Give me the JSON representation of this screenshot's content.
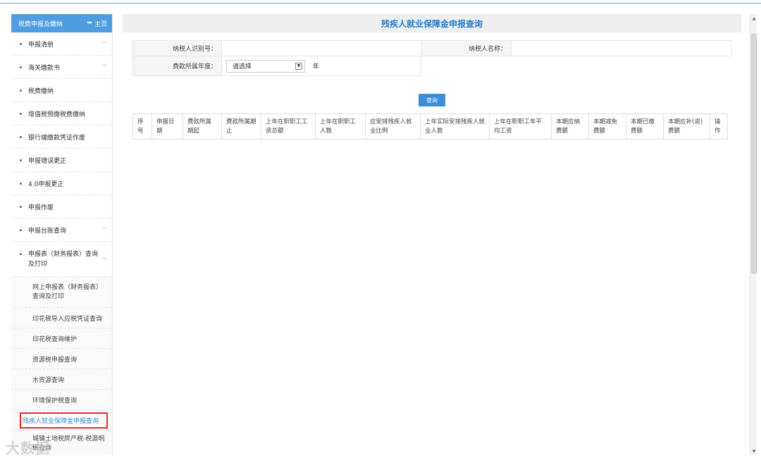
{
  "sidebar": {
    "header_title": "税费申报及缴纳",
    "home_label": "主页",
    "items": [
      {
        "label": "申报清册",
        "expandable": true
      },
      {
        "label": "海关缴款书",
        "expandable": true
      },
      {
        "label": "税费缴纳",
        "expandable": false
      },
      {
        "label": "增值税预缴税费缴纳",
        "expandable": false
      },
      {
        "label": "银行端缴款凭证作废",
        "expandable": false
      },
      {
        "label": "申报错误更正",
        "expandable": false
      },
      {
        "label": "4.0申报更正",
        "expandable": false
      },
      {
        "label": "申报作废",
        "expandable": false
      },
      {
        "label": "申报台账查询",
        "expandable": true
      },
      {
        "label": "申报表（财务报表）查询及打印",
        "expandable": true
      }
    ],
    "subitems": [
      "网上申报表（财务报表）查询及打印",
      "印花税导入应税凭证查询",
      "印花税查询维护",
      "资源税申报查询",
      "水资源查询",
      "环境保护税查询",
      "残疾人就业保障金申报查询",
      "城镇土地税房产税-税源明细查询"
    ]
  },
  "watermark": "大数据",
  "page_title": "残疾人就业保障金申报查询",
  "form": {
    "taxpayer_id_label": "纳税人识别号：",
    "taxpayer_id_value": "",
    "taxpayer_name_label": "纳税人名称：",
    "taxpayer_name_value": "",
    "year_label": "费款所属年度：",
    "year_select": "请选择",
    "year_unit": "年"
  },
  "query_button": "查询",
  "table": {
    "columns": [
      "序号",
      "申报日期",
      "费款所属期起",
      "费款所属期止",
      "上年在职职工工资总额",
      "上年在职职工人数",
      "应安排残疾人就业比例",
      "上年实际安排残疾人就业人数",
      "上年在职职工年平均工资",
      "本期应纳费额",
      "本期减免费额",
      "本期已缴费额",
      "本期应补(退)费额",
      "操作"
    ],
    "rows": []
  }
}
